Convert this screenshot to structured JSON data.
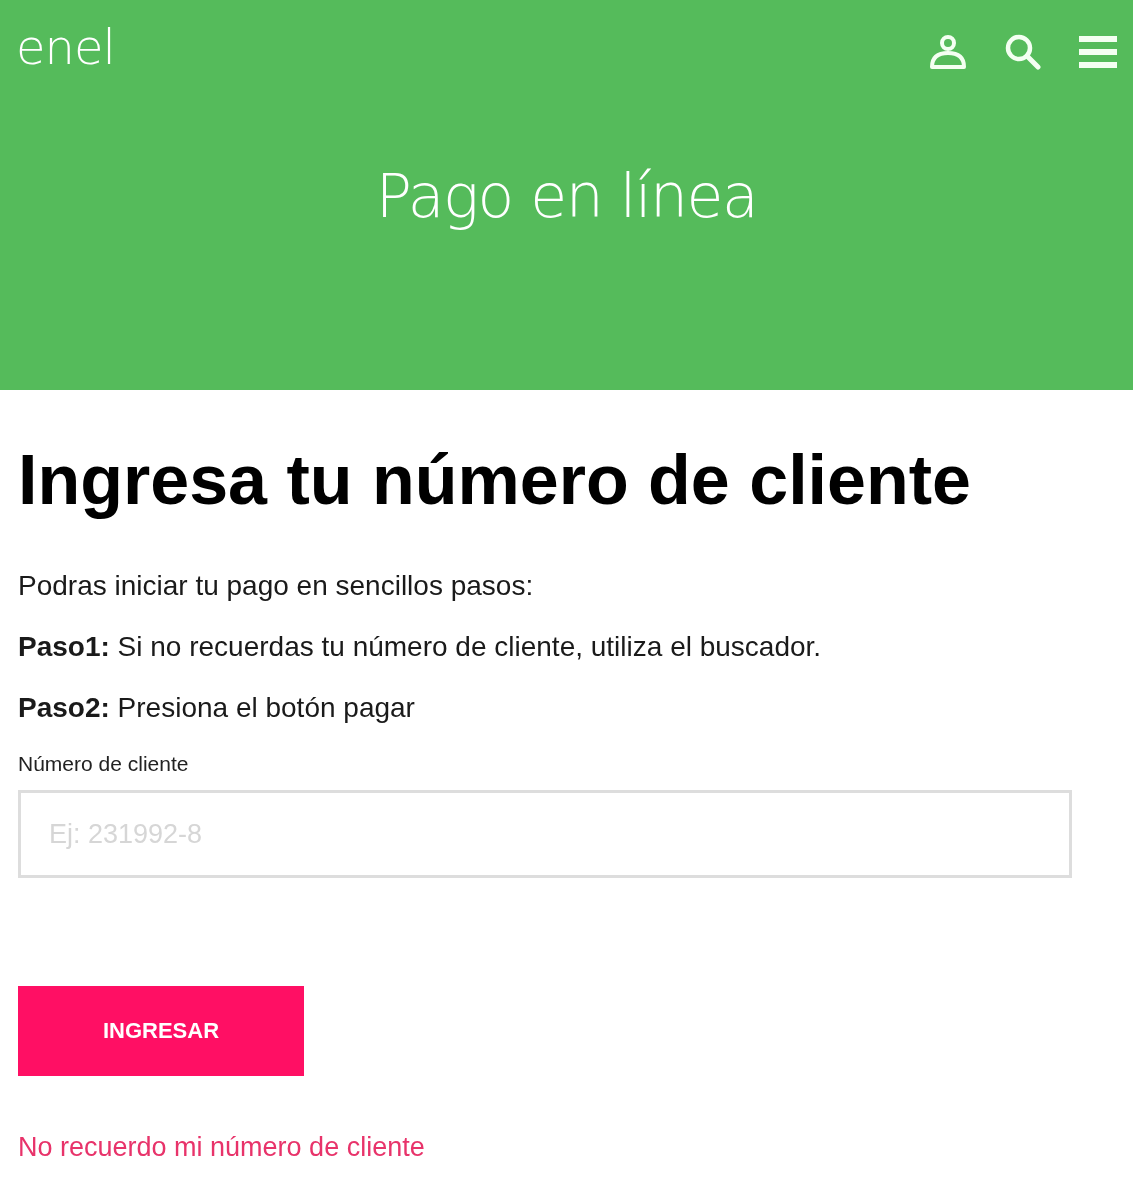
{
  "header": {
    "logo": "enel",
    "icons": [
      {
        "kind": "user"
      },
      {
        "kind": "search"
      },
      {
        "kind": "menu"
      }
    ]
  },
  "hero": {
    "title": "Pago en línea"
  },
  "main": {
    "heading": "Ingresa tu número de cliente",
    "paragraphs": [
      "Podras iniciar tu pago en sencillos pasos:",
      "**Paso1:** Si no recuerdas tu número de cliente, utiliza el buscador.",
      "**Paso2:** Presiona el botón pagar"
    ],
    "field": {
      "label": "Número de cliente",
      "placeholder": "Ej: 231992-8"
    },
    "button": "INGRESAR",
    "link": "No recuerdo mi número de cliente"
  }
}
